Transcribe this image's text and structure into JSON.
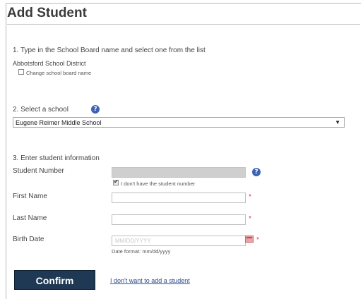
{
  "page": {
    "title": "Add Student"
  },
  "board": {
    "step_label": "1. Type in the School Board name and select one from the list",
    "selected_board": "Abbotsford School District",
    "change_label": "Change school board name"
  },
  "school": {
    "step_label": "2. Select a school",
    "selected_value": "Eugene Reimer Middle School"
  },
  "student": {
    "step_label": "3. Enter student information",
    "student_number_label": "Student Number",
    "no_number_label": "I don't have the student number",
    "first_name_label": "First Name",
    "last_name_label": "Last Name",
    "birth_date_label": "Birth Date",
    "birth_date_placeholder": "MM/DD/YYYY",
    "date_format_hint": "Date format: mm/dd/yyyy"
  },
  "actions": {
    "confirm_label": "Confirm",
    "cancel_link": "I don't want to add a student"
  }
}
